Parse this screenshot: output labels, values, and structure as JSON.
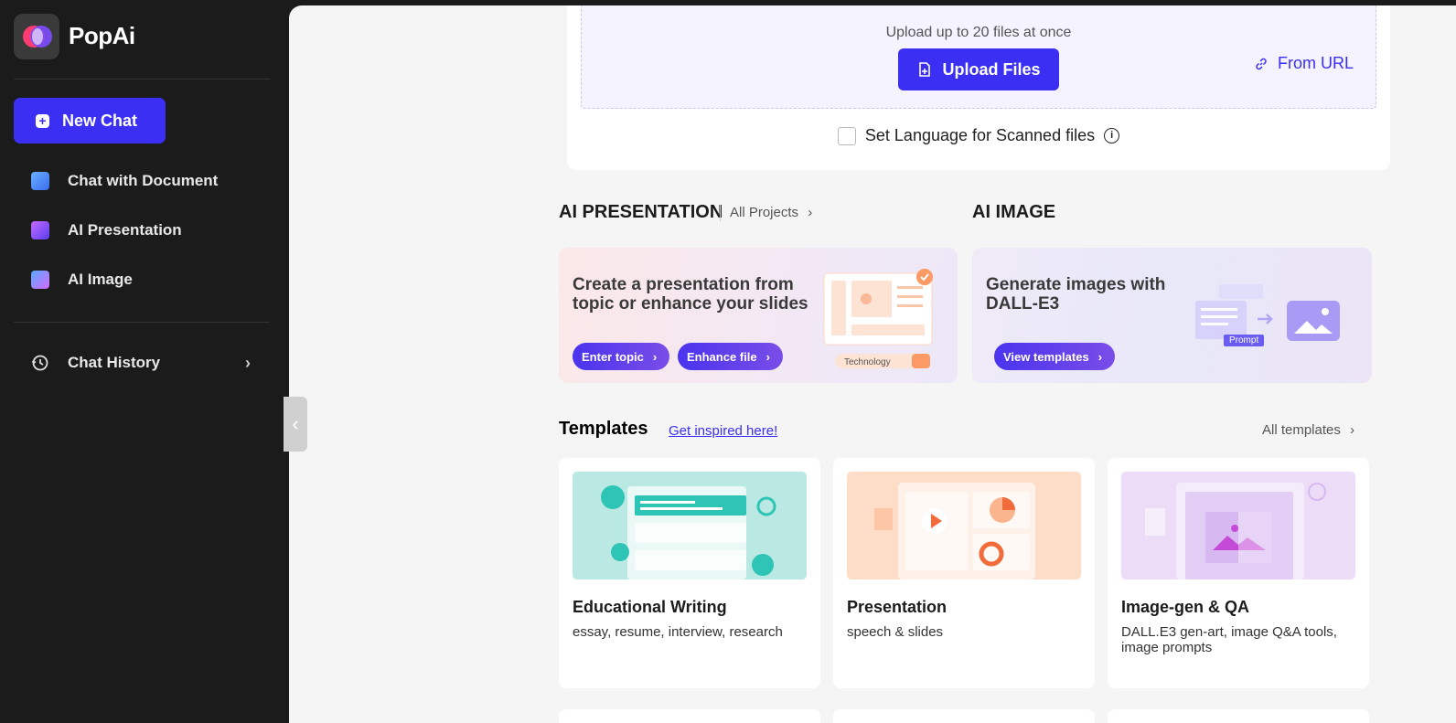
{
  "app": {
    "name": "PopAi"
  },
  "sidebar": {
    "new_chat": "New Chat",
    "items": [
      {
        "label": "Chat with Document",
        "icon": "folder-icon"
      },
      {
        "label": "AI Presentation",
        "icon": "presentation-edit-icon"
      },
      {
        "label": "AI Image",
        "icon": "image-sparkle-icon"
      }
    ],
    "history": "Chat History"
  },
  "upload": {
    "hint": "Upload up to 20 files at once",
    "button": "Upload Files",
    "from_url": "From URL",
    "language": "Set Language for Scanned files"
  },
  "ai_presentation": {
    "title": "AI PRESENTATION",
    "link": "All Projects",
    "text": "Create a presentation from topic or enhance your slides",
    "btn_topic": "Enter topic",
    "btn_file": "Enhance file",
    "illustration_label": "Technology"
  },
  "ai_image": {
    "title": "AI IMAGE",
    "text": "Generate images with DALL-E3",
    "btn": "View templates",
    "illustration_label": "Prompt"
  },
  "templates": {
    "title": "Templates",
    "inspired": "Get inspired here!",
    "all": "All templates",
    "cards": [
      {
        "title": "Educational Writing",
        "desc": "essay, resume, interview, research",
        "color": "#b9e9e2"
      },
      {
        "title": "Presentation",
        "desc": "speech & slides",
        "color": "#fddcc8"
      },
      {
        "title": "Image-gen & QA",
        "desc": "DALL.E3 gen-art, image Q&A tools, image prompts",
        "color": "#ecdcf7"
      }
    ]
  },
  "colors": {
    "accent": "#3a2ff2",
    "sidebar_bg": "#1b1b1b",
    "main_bg": "#f5f5f5"
  }
}
